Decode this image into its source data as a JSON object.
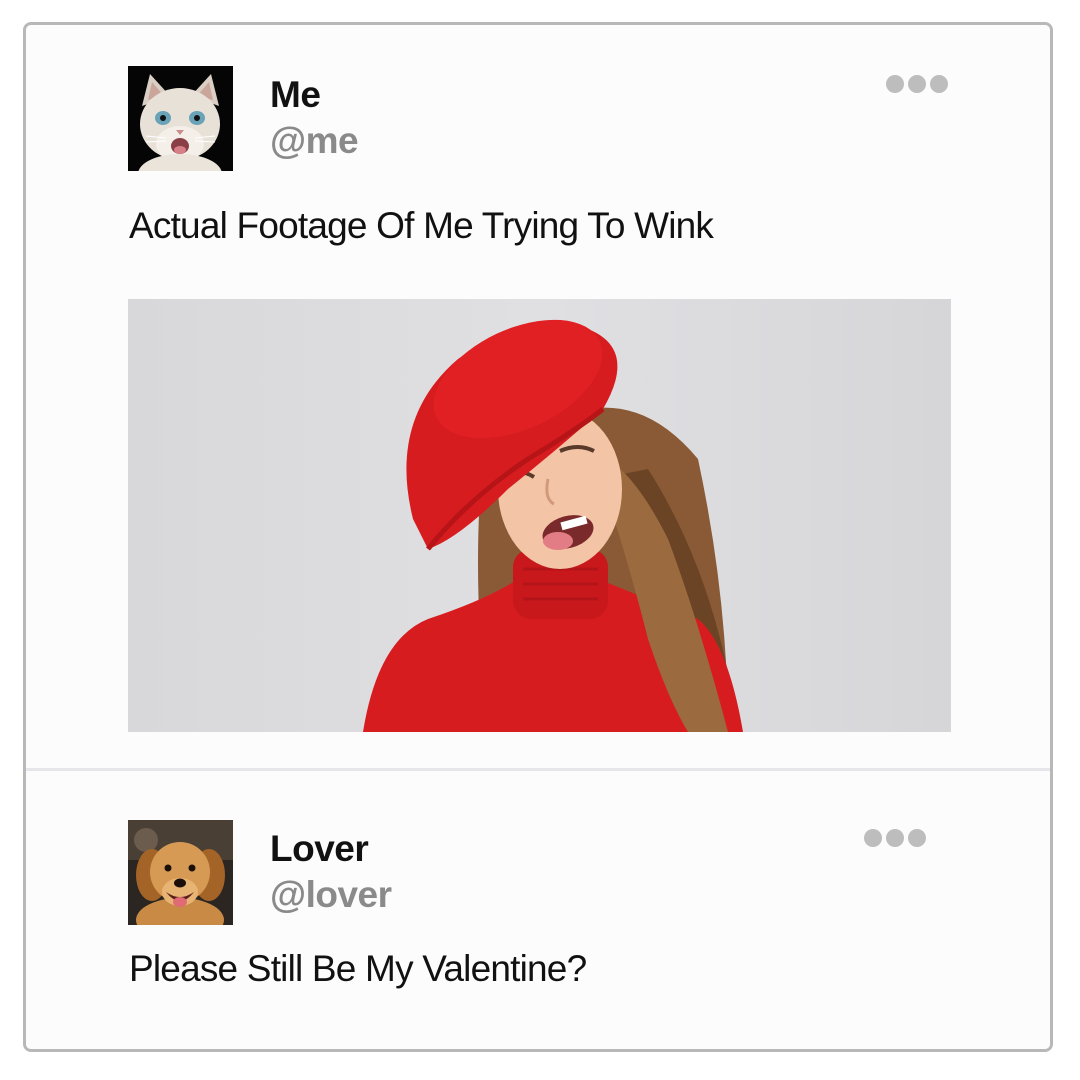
{
  "posts": [
    {
      "display_name": "Me",
      "handle": "@me",
      "avatar": "cat-avatar",
      "text": "Actual Footage Of Me Trying To Wink",
      "media": "photo-girl-red-beret-winking",
      "more_icon": "more-options-icon"
    },
    {
      "display_name": "Lover",
      "handle": "@lover",
      "avatar": "dog-avatar",
      "text": "Please Still Be My Valentine?",
      "more_icon": "more-options-icon"
    }
  ],
  "colors": {
    "name": "#111111",
    "handle": "#8a8a8a",
    "dots": "#bdbdbd",
    "border": "#b8b8b8",
    "beret_red": "#d71c1f"
  }
}
